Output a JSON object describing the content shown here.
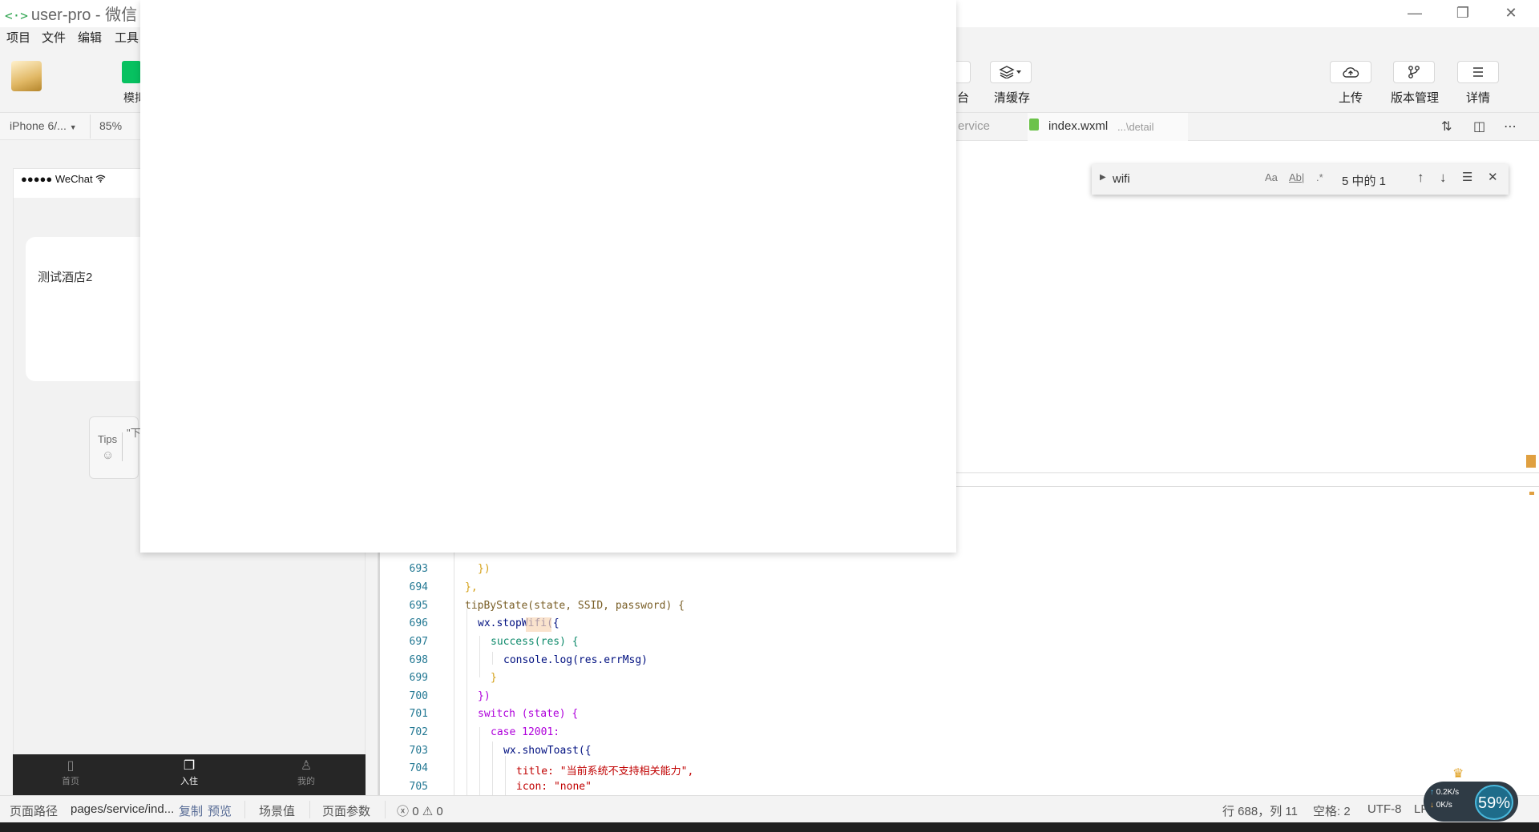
{
  "window": {
    "title_logo": "<·>",
    "title": "user-pro - 微信",
    "controls": {
      "minimize": "—",
      "restore": "❐",
      "close": "✕"
    }
  },
  "menu": [
    "项目",
    "文件",
    "编辑",
    "工具"
  ],
  "toolbar": {
    "simulator_label": "模拟",
    "platform_label": "台",
    "clear_cache_label": "清缓存",
    "upload_label": "上传",
    "version_label": "版本管理",
    "details_label": "详情"
  },
  "device_bar": {
    "device": "iPhone 6/...",
    "zoom": "85%"
  },
  "simulator": {
    "carrier": "●●●●● WeChat",
    "hotel_name": "测试酒店2",
    "tips_label": "Tips",
    "tips_quote": "\"下",
    "tabs": [
      {
        "label": "首页",
        "icon": "home-icon"
      },
      {
        "label": "入住",
        "icon": "checkin-icon"
      },
      {
        "label": "我的",
        "icon": "user-icon"
      }
    ],
    "active_tab": 1
  },
  "editor_tabs": {
    "prev_tab_fragment": "ervice",
    "active_tab": {
      "name": "index.wxml",
      "path": "...\\detail"
    }
  },
  "find": {
    "query": "wifi",
    "match_case": "Aa",
    "whole_word": "Ab|",
    "regex": ".*",
    "count": "5 中的 1"
  },
  "code_lines": [
    {
      "no": "693",
      "text": "})"
    },
    {
      "no": "694",
      "text": "},"
    },
    {
      "no": "695",
      "text": "tipByState(state, SSID, password) {"
    },
    {
      "no": "696",
      "text": "wx.stopWifi({"
    },
    {
      "no": "697",
      "text": "success(res) {"
    },
    {
      "no": "698",
      "text": "console.log(res.errMsg)"
    },
    {
      "no": "699",
      "text": "}"
    },
    {
      "no": "700",
      "text": "})"
    },
    {
      "no": "701",
      "text": "switch (state) {"
    },
    {
      "no": "702",
      "text": "case 12001:"
    },
    {
      "no": "703",
      "text": "wx.showToast({"
    },
    {
      "no": "704",
      "text": "title: \"当前系统不支持相关能力\","
    },
    {
      "no": "705",
      "text": "icon: \"none\""
    }
  ],
  "statusbar": {
    "page_path_label": "页面路径",
    "page_path": "pages/service/ind...",
    "copy": "复制",
    "preview": "预览",
    "scene_value": "场景值",
    "page_params": "页面参数",
    "errors": "0",
    "warnings": "0",
    "cursor": "行 688，列 11",
    "indent": "空格: 2",
    "encoding": "UTF-8",
    "eol": "LF"
  },
  "network": {
    "upload_rate": "0.2K/s",
    "download_rate": "0K/s",
    "percent": "59%"
  }
}
